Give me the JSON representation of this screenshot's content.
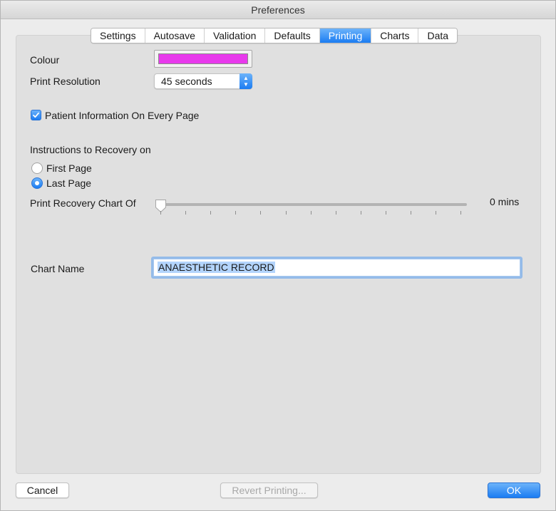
{
  "window": {
    "title": "Preferences"
  },
  "tabs": [
    {
      "label": "Settings"
    },
    {
      "label": "Autosave"
    },
    {
      "label": "Validation"
    },
    {
      "label": "Defaults"
    },
    {
      "label": "Printing",
      "active": true
    },
    {
      "label": "Charts"
    },
    {
      "label": "Data"
    }
  ],
  "printing": {
    "colour_label": "Colour",
    "colour_value": "#e839ec",
    "resolution_label": "Print Resolution",
    "resolution_value": "45 seconds",
    "patient_info_label": "Patient Information On Every Page",
    "patient_info_checked": true,
    "instructions_label": "Instructions to Recovery on",
    "radio_first_label": "First Page",
    "radio_last_label": "Last Page",
    "radio_selected": "Last Page",
    "recovery_chart_label": "Print Recovery Chart Of",
    "recovery_chart_value_text": "0 mins",
    "recovery_chart_level": 0,
    "chart_name_label": "Chart Name",
    "chart_name_value": "ANAESTHETIC RECORD"
  },
  "buttons": {
    "cancel": "Cancel",
    "revert": "Revert Printing...",
    "ok": "OK"
  },
  "colors": {
    "accent": "#1b7cf2",
    "swatch": "#e839ec"
  }
}
